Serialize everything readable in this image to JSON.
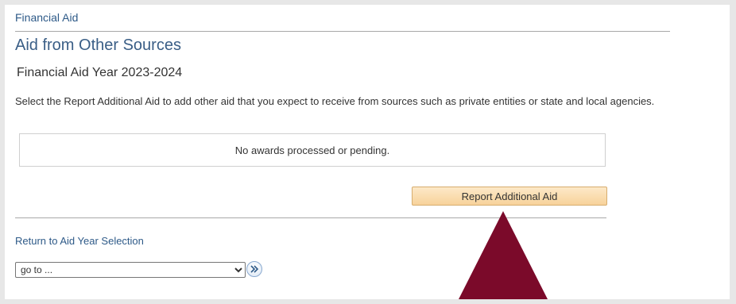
{
  "breadcrumb": {
    "label": "Financial Aid"
  },
  "page_title": "Aid from Other Sources",
  "aid_year": "Financial Aid Year 2023-2024",
  "instructions": "Select the Report Additional Aid to add other aid that you expect to receive from sources such as private entities or state and local agencies.",
  "awards": {
    "empty_message": "No awards processed or pending."
  },
  "report_button": {
    "label": "Report Additional Aid"
  },
  "return_link": {
    "label": "Return to Aid Year Selection"
  },
  "goto": {
    "selected": "go to ...",
    "go_icon": "double-chevron-right-icon"
  },
  "annotation": {
    "icon": "pointer-triangle",
    "color": "#7b0a2a"
  },
  "colors": {
    "link": "#2e5a88",
    "title": "#3a5e86",
    "button_fill": "#f7d29b",
    "annotation": "#7b0a2a"
  }
}
